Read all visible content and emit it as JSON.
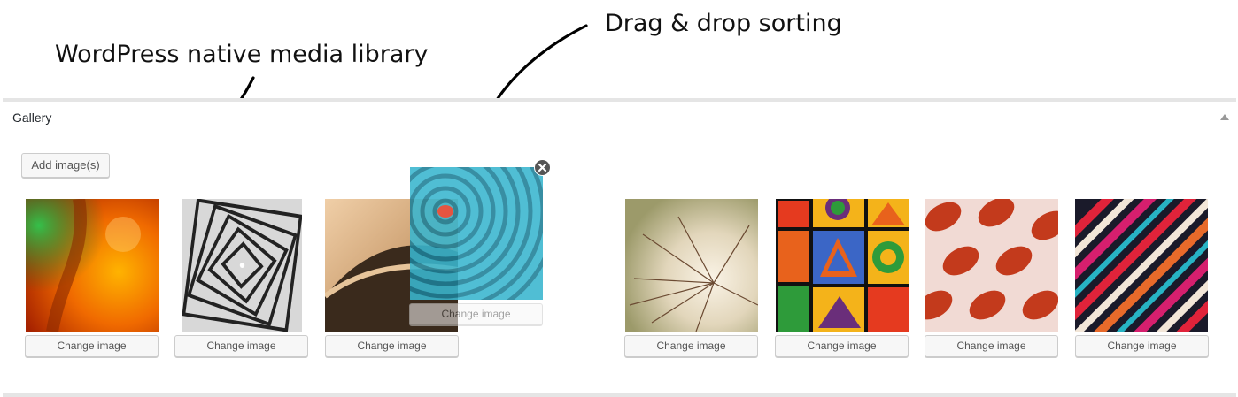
{
  "annotations": {
    "media_library": "WordPress native media library",
    "drag_drop": "Drag & drop sorting"
  },
  "panel": {
    "title": "Gallery",
    "add_button": "Add image(s)"
  },
  "gallery": {
    "change_label": "Change image",
    "dragged_change_label": "Change image",
    "items": [
      {
        "change_label": "Change image"
      },
      {
        "change_label": "Change image"
      },
      {
        "change_label": "Change image"
      },
      {
        "change_label": "Change image"
      },
      {
        "change_label": "Change image"
      },
      {
        "change_label": "Change image"
      },
      {
        "change_label": "Change image"
      }
    ]
  },
  "colors": {
    "border": "#e5e5e5",
    "button_bg": "#f7f7f7",
    "button_border": "#cccccc",
    "text": "#555555",
    "title": "#23282d"
  }
}
